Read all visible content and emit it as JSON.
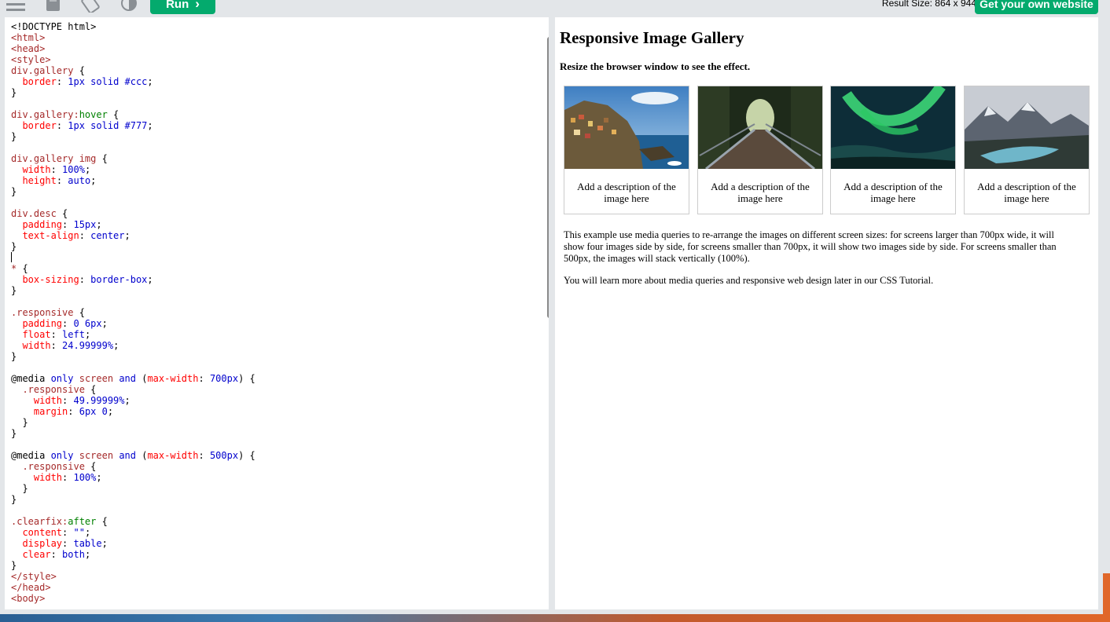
{
  "toolbar": {
    "icons": [
      "menu-icon",
      "save-icon",
      "rotate-icon",
      "contrast-icon"
    ],
    "run_label": "Run",
    "run_chevron": "›",
    "result_size": "Result Size: 864 x 944",
    "get_site_label": "Get your own website"
  },
  "code": {
    "lines": [
      "<!DOCTYPE html>",
      "<html>",
      "<head>",
      "<style>",
      "div.gallery {",
      "  border: 1px solid #ccc;",
      "}",
      "",
      "div.gallery:hover {",
      "  border: 1px solid #777;",
      "}",
      "",
      "div.gallery img {",
      "  width: 100%;",
      "  height: auto;",
      "}",
      "",
      "div.desc {",
      "  padding: 15px;",
      "  text-align: center;",
      "}",
      "",
      "* {",
      "  box-sizing: border-box;",
      "}",
      "",
      ".responsive {",
      "  padding: 0 6px;",
      "  float: left;",
      "  width: 24.99999%;",
      "}",
      "",
      "@media only screen and (max-width: 700px) {",
      "  .responsive {",
      "    width: 49.99999%;",
      "    margin: 6px 0;",
      "  }",
      "}",
      "",
      "@media only screen and (max-width: 500px) {",
      "  .responsive {",
      "    width: 100%;",
      "  }",
      "}",
      "",
      ".clearfix:after {",
      "  content: \"\";",
      "  display: table;",
      "  clear: both;",
      "}",
      "</style>",
      "</head>",
      "<body>"
    ]
  },
  "result": {
    "title": "Responsive Image Gallery",
    "subtitle": "Resize the browser window to see the effect.",
    "gallery": [
      {
        "image": "cinque-terre-coastal-village",
        "desc": "Add a description of the image here"
      },
      {
        "image": "forest-bridge",
        "desc": "Add a description of the image here"
      },
      {
        "image": "northern-lights",
        "desc": "Add a description of the image here"
      },
      {
        "image": "mountain-lake",
        "desc": "Add a description of the image here"
      }
    ],
    "paragraph1": "This example use media queries to re-arrange the images on different screen sizes: for screens larger than 700px wide, it will show four images side by side, for screens smaller than 700px, it will show two images side by side. For screens smaller than 500px, the images will stack vertically (100%).",
    "paragraph2": "You will learn more about media queries and responsive web design later in our CSS Tutorial."
  },
  "colors": {
    "accent": "#04aa6d",
    "editor_bg": "#ffffff",
    "chrome_bg": "#e3e6e9",
    "gallery_border": "#cccccc"
  }
}
